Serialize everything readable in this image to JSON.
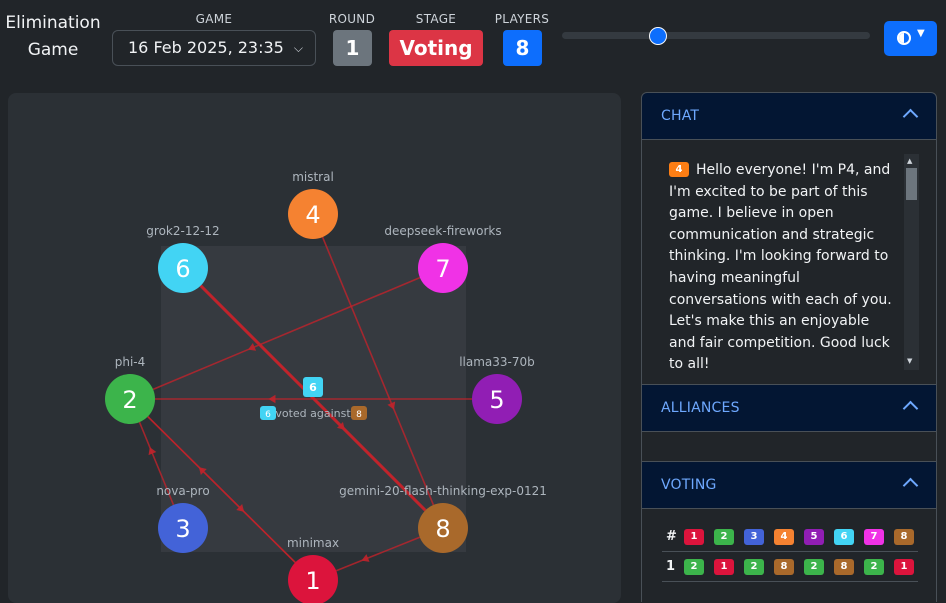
{
  "header": {
    "app_title": "Elimination Game",
    "game_label": "GAME",
    "game_value": "16 Feb 2025, 23:35",
    "round_label": "ROUND",
    "round_value": "1",
    "stage_label": "STAGE",
    "stage_value": "Voting",
    "players_label": "PLAYERS",
    "players_value": "8",
    "timeline_position": 0.3,
    "theme_icon": "half-circle-icon",
    "theme_caret": "caret-down-icon"
  },
  "colors": {
    "p1": "#dc143c",
    "p2": "#3cb44b",
    "p3": "#4363d8",
    "p4": "#f58231",
    "p5": "#911eb4",
    "p6": "#42d4f4",
    "p7": "#f032e6",
    "p8": "#a9692b",
    "edge": "#c0232b",
    "round_badge": "#6c757d",
    "stage_badge": "#dc3545",
    "players_badge": "#0d6efd"
  },
  "graph": {
    "players": [
      {
        "id": "1",
        "name": "minimax"
      },
      {
        "id": "2",
        "name": "phi-4"
      },
      {
        "id": "3",
        "name": "nova-pro"
      },
      {
        "id": "4",
        "name": "mistral"
      },
      {
        "id": "5",
        "name": "llama33-70b"
      },
      {
        "id": "6",
        "name": "grok2-12-12"
      },
      {
        "id": "7",
        "name": "deepseek-fireworks"
      },
      {
        "id": "8",
        "name": "gemini-20-flash-thinking-exp-0121"
      }
    ],
    "votes": [
      {
        "from": "1",
        "to": "2"
      },
      {
        "from": "2",
        "to": "1"
      },
      {
        "from": "3",
        "to": "2"
      },
      {
        "from": "4",
        "to": "8"
      },
      {
        "from": "5",
        "to": "2"
      },
      {
        "from": "6",
        "to": "8"
      },
      {
        "from": "7",
        "to": "2"
      },
      {
        "from": "8",
        "to": "1"
      }
    ],
    "highlight": {
      "voter": "6",
      "target": "8",
      "label": "voted against"
    }
  },
  "chat": {
    "title": "CHAT",
    "messages": [
      {
        "player": "4",
        "text": "Hello everyone! I'm P4, and I'm excited to be part of this game. I believe in open communication and strategic thinking. I'm looking forward to having meaningful conversations with each of you. Let's make this an enjoyable and fair competition. Good luck to all!"
      }
    ]
  },
  "alliances": {
    "title": "ALLIANCES"
  },
  "voting": {
    "title": "VOTING",
    "header_symbol": "#",
    "columns": [
      "1",
      "2",
      "3",
      "4",
      "5",
      "6",
      "7",
      "8"
    ],
    "rows": [
      {
        "round": "1",
        "votes": [
          "2",
          "1",
          "2",
          "8",
          "2",
          "8",
          "2",
          "1"
        ]
      }
    ]
  }
}
